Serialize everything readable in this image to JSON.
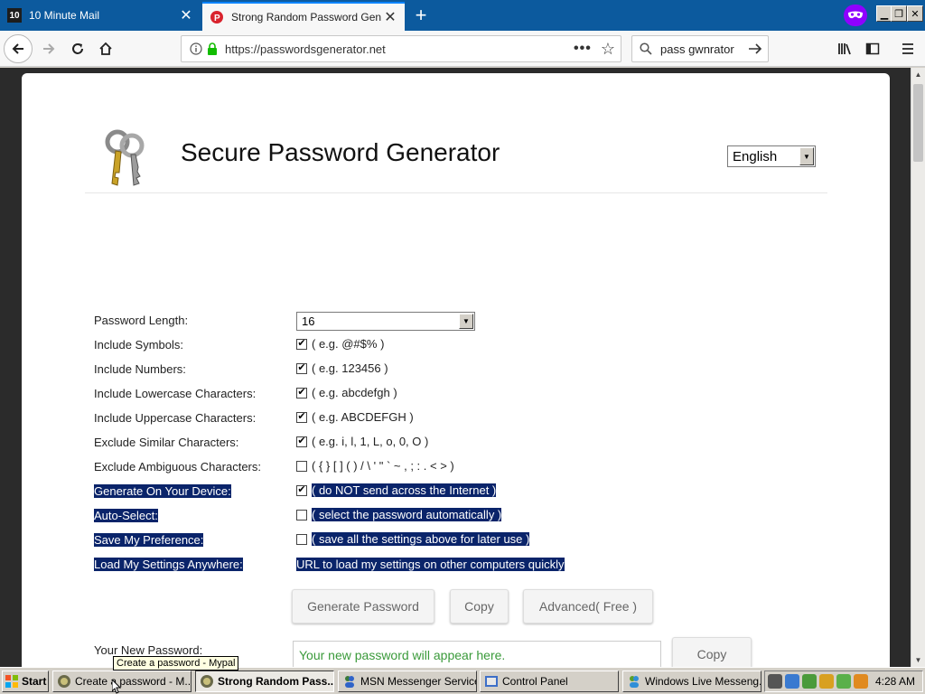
{
  "browser": {
    "tabs": [
      {
        "title": "10 Minute Mail",
        "favicon_text": "10"
      },
      {
        "title": "Strong Random Password Generat"
      }
    ],
    "url": "https://passwordsgenerator.net",
    "search_value": "pass gwnrator"
  },
  "page": {
    "title": "Secure Password Generator",
    "language": "English",
    "options": [
      {
        "label": "Password Length:",
        "value": "16",
        "kind": "select"
      },
      {
        "label": "Include Symbols:",
        "value": "( e.g. @#$% )",
        "checked": true
      },
      {
        "label": "Include Numbers:",
        "value": "( e.g. 123456 )",
        "checked": true
      },
      {
        "label": "Include Lowercase Characters:",
        "value": "( e.g. abcdefgh )",
        "checked": true
      },
      {
        "label": "Include Uppercase Characters:",
        "value": "( e.g. ABCDEFGH )",
        "checked": true
      },
      {
        "label": "Exclude Similar Characters:",
        "value": "( e.g. i, l, 1, L, o, 0, O )",
        "checked": true
      },
      {
        "label": "Exclude Ambiguous Characters:",
        "value": "( { } [ ] ( ) / \\ ' \" ` ~ , ; : . < > )",
        "checked": false
      },
      {
        "label": "Generate On Your Device:",
        "value": "( do NOT send across the Internet )",
        "checked": true,
        "highlighted": true
      },
      {
        "label": "Auto-Select:",
        "value": "( select the password automatically )",
        "checked": false,
        "highlighted": true
      },
      {
        "label": "Save My Preference:",
        "value": "( save all the settings above for later use )",
        "checked": false,
        "highlighted": true
      },
      {
        "label": "Load My Settings Anywhere:",
        "value": "URL to load my settings on other computers quickly",
        "kind": "link",
        "highlighted": true
      }
    ],
    "buttons": {
      "generate": "Generate Password",
      "copy": "Copy",
      "advanced": "Advanced( Free )"
    },
    "new_password_label": "Your New Password:",
    "new_password_placeholder": "Your new password will appear here.",
    "copy_new": "Copy"
  },
  "taskbar": {
    "start": "Start",
    "items": [
      {
        "label": "Create a password - M...",
        "active": false
      },
      {
        "label": "Strong Random Pass...",
        "active": true
      },
      {
        "label": "MSN Messenger Service",
        "active": false
      },
      {
        "label": "Control Panel",
        "active": false
      },
      {
        "label": "Windows Live Messeng...",
        "active": false
      }
    ],
    "clock": "4:28 AM",
    "tooltip": "Create a password - Mypal"
  },
  "colors": {
    "tabstrip": "#0c5a9e",
    "active_tab_line": "#0a84ff",
    "highlight": "#0a246a",
    "placeholder_green": "#3a9a3a",
    "private_badge": "#8f00ff"
  }
}
